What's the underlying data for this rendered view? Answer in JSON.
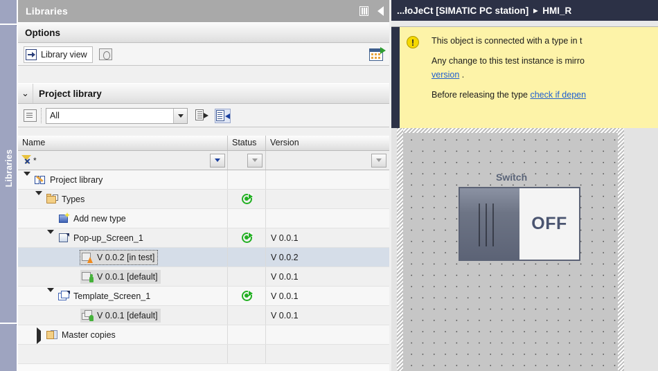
{
  "dock": {
    "vertical_tab_label": "Libraries"
  },
  "libraries_panel": {
    "title": "Libraries",
    "title_icons": {
      "columns": "columns-icon",
      "collapse": "collapse-left-icon"
    },
    "options": {
      "header": "Options",
      "library_view_label": "Library view",
      "book_icon": "open-book-icon",
      "export_icon": "export-table-icon"
    },
    "project_library": {
      "header": "Project library",
      "chevron": "⌄",
      "filter_value": "All",
      "catalog_icon": "catalog-icon",
      "list_out_icon": "list-arrow-right-icon",
      "list_in_icon": "list-arrow-left-icon"
    },
    "table": {
      "columns": [
        "Name",
        "Status",
        "Version"
      ],
      "filter_row": {
        "pattern": "*",
        "funnel_icon": "filter-clear-icon"
      },
      "rows": [
        {
          "name": "Project library",
          "indent": 0,
          "twisty": "down",
          "icon": "library-book-icon",
          "status": "",
          "version": "",
          "selected": false,
          "highlight": false
        },
        {
          "name": "Types",
          "indent": 1,
          "twisty": "down",
          "icon": "folder-types-icon",
          "status": "sync-icon",
          "version": "",
          "selected": false,
          "highlight": false
        },
        {
          "name": "Add new type",
          "indent": 2,
          "twisty": "none",
          "icon": "add-new-type-icon",
          "status": "",
          "version": "",
          "selected": false,
          "highlight": false
        },
        {
          "name": "Pop-up_Screen_1",
          "indent": 2,
          "twisty": "down",
          "icon": "popup-screen-icon",
          "status": "sync-icon",
          "version": "V 0.0.1",
          "selected": false,
          "highlight": false
        },
        {
          "name": "V 0.0.2 [in test]",
          "indent": 4,
          "twisty": "none",
          "icon": "version-test-icon",
          "status": "",
          "version": "V 0.0.2",
          "selected": true,
          "highlight": false
        },
        {
          "name": "V 0.0.1 [default]",
          "indent": 4,
          "twisty": "none",
          "icon": "version-default-icon",
          "status": "",
          "version": "V 0.0.1",
          "selected": false,
          "highlight": true
        },
        {
          "name": "Template_Screen_1",
          "indent": 2,
          "twisty": "down",
          "icon": "template-screen-icon",
          "status": "sync-icon",
          "version": "V 0.0.1",
          "selected": false,
          "highlight": false
        },
        {
          "name": "V 0.0.1 [default]",
          "indent": 4,
          "twisty": "none",
          "icon": "template-version-icon",
          "status": "",
          "version": "V 0.0.1",
          "selected": false,
          "highlight": true
        },
        {
          "name": "Master copies",
          "indent": 1,
          "twisty": "right",
          "icon": "master-copies-icon",
          "status": "",
          "version": "",
          "selected": false,
          "highlight": false
        },
        {
          "name": "",
          "indent": 0,
          "twisty": "none",
          "icon": "",
          "status": "",
          "version": "",
          "selected": false,
          "highlight": false
        }
      ]
    }
  },
  "editor": {
    "breadcrumb": {
      "part1": "...łoJeCt [SIMATIC PC station]",
      "separator": "▸",
      "part2": "HMI_R"
    },
    "warning": {
      "icon": "warning-exclamation-icon",
      "line1": "This object is connected with a type in t",
      "line2a": "Any change to this test instance is mirro",
      "line2b": "version",
      "line2c": ".",
      "line3a": "Before releasing the type ",
      "line3b": "check if depen"
    },
    "canvas": {
      "switch_caption": "Switch",
      "switch_state": "OFF"
    }
  },
  "colors": {
    "title_bar": "#a9a9a9",
    "breadcrumb_bg": "#2c3146",
    "warning_bg": "#fdf3a8",
    "selection": "#d5dde8",
    "sync_green": "#22b022",
    "link": "#1f5fd0",
    "dock_tab": "#9ea4c0"
  }
}
